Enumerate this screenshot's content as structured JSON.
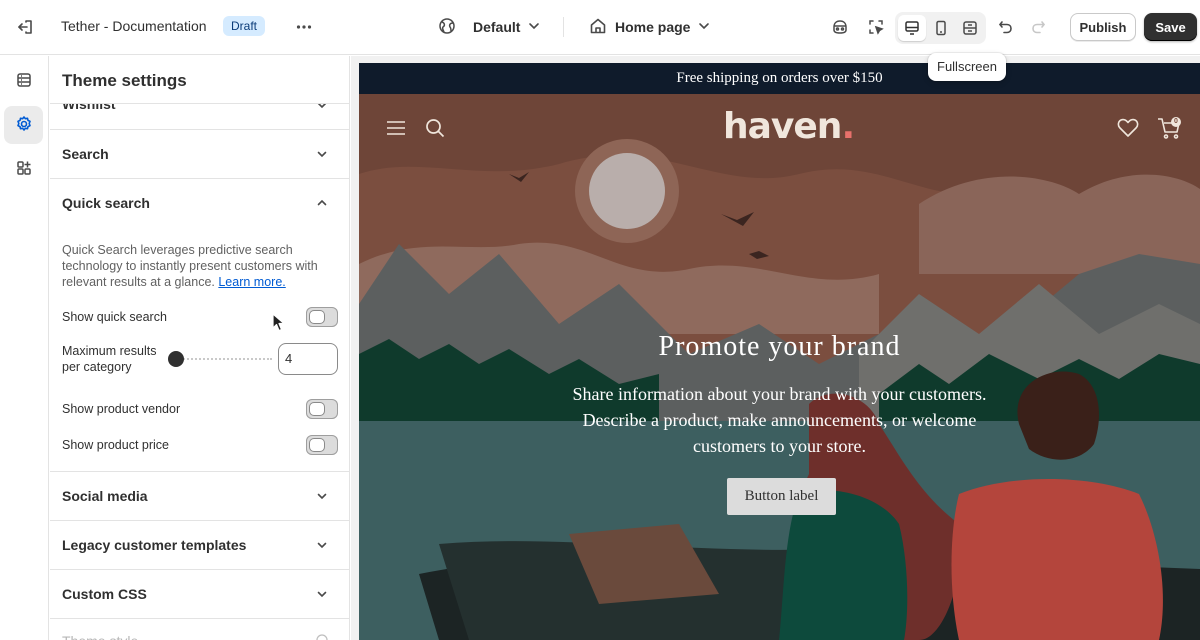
{
  "topbar": {
    "doc_title": "Tether - Documentation",
    "status_badge": "Draft",
    "theme_select": "Default",
    "page_select": "Home page",
    "publish_label": "Publish",
    "save_label": "Save",
    "tooltip": "Fullscreen",
    "icons": [
      "exit-icon",
      "more-icon",
      "globe-icon",
      "home-icon",
      "chevron-down-icon",
      "ai-agent-icon",
      "inspector-icon",
      "desktop-icon",
      "mobile-icon",
      "fullscreen-icon",
      "undo-icon",
      "redo-icon"
    ]
  },
  "rail": {
    "items": [
      {
        "name": "sections",
        "icon": "sections-icon",
        "active": false
      },
      {
        "name": "theme-settings",
        "icon": "gear-icon",
        "active": true
      },
      {
        "name": "apps",
        "icon": "apps-icon",
        "active": false
      }
    ]
  },
  "panel": {
    "title": "Theme settings",
    "sections": {
      "wishlist": "Wishlist",
      "search": "Search",
      "quick_search": "Quick search",
      "social_media": "Social media",
      "legacy_templates": "Legacy customer templates",
      "custom_css": "Custom CSS",
      "theme_style": "Theme style"
    },
    "quick_search": {
      "description": "Quick Search leverages predictive search technology to instantly present customers with relevant results at a glance.",
      "learn_more": "Learn more.",
      "show_quick_search": {
        "label": "Show quick search",
        "on": false
      },
      "max_results": {
        "label": "Maximum results per category",
        "value": "4"
      },
      "show_vendor": {
        "label": "Show product vendor",
        "on": false
      },
      "show_price": {
        "label": "Show product price",
        "on": false
      }
    }
  },
  "preview": {
    "announcement": "Free shipping on orders over $150",
    "logo_text": "haven",
    "logo_dot": ".",
    "cart_count": "0",
    "hero_heading": "Promote your brand",
    "hero_text": "Share information about your brand with your customers. Describe a product, make announcements, or welcome customers to your store.",
    "hero_button": "Button label"
  },
  "colors": {
    "save_bg": "#303030",
    "badge_bg": "#d5ebff",
    "link": "#005bd3",
    "announcement_bg": "#0f1b2b",
    "logo_dot": "#e8716b"
  }
}
